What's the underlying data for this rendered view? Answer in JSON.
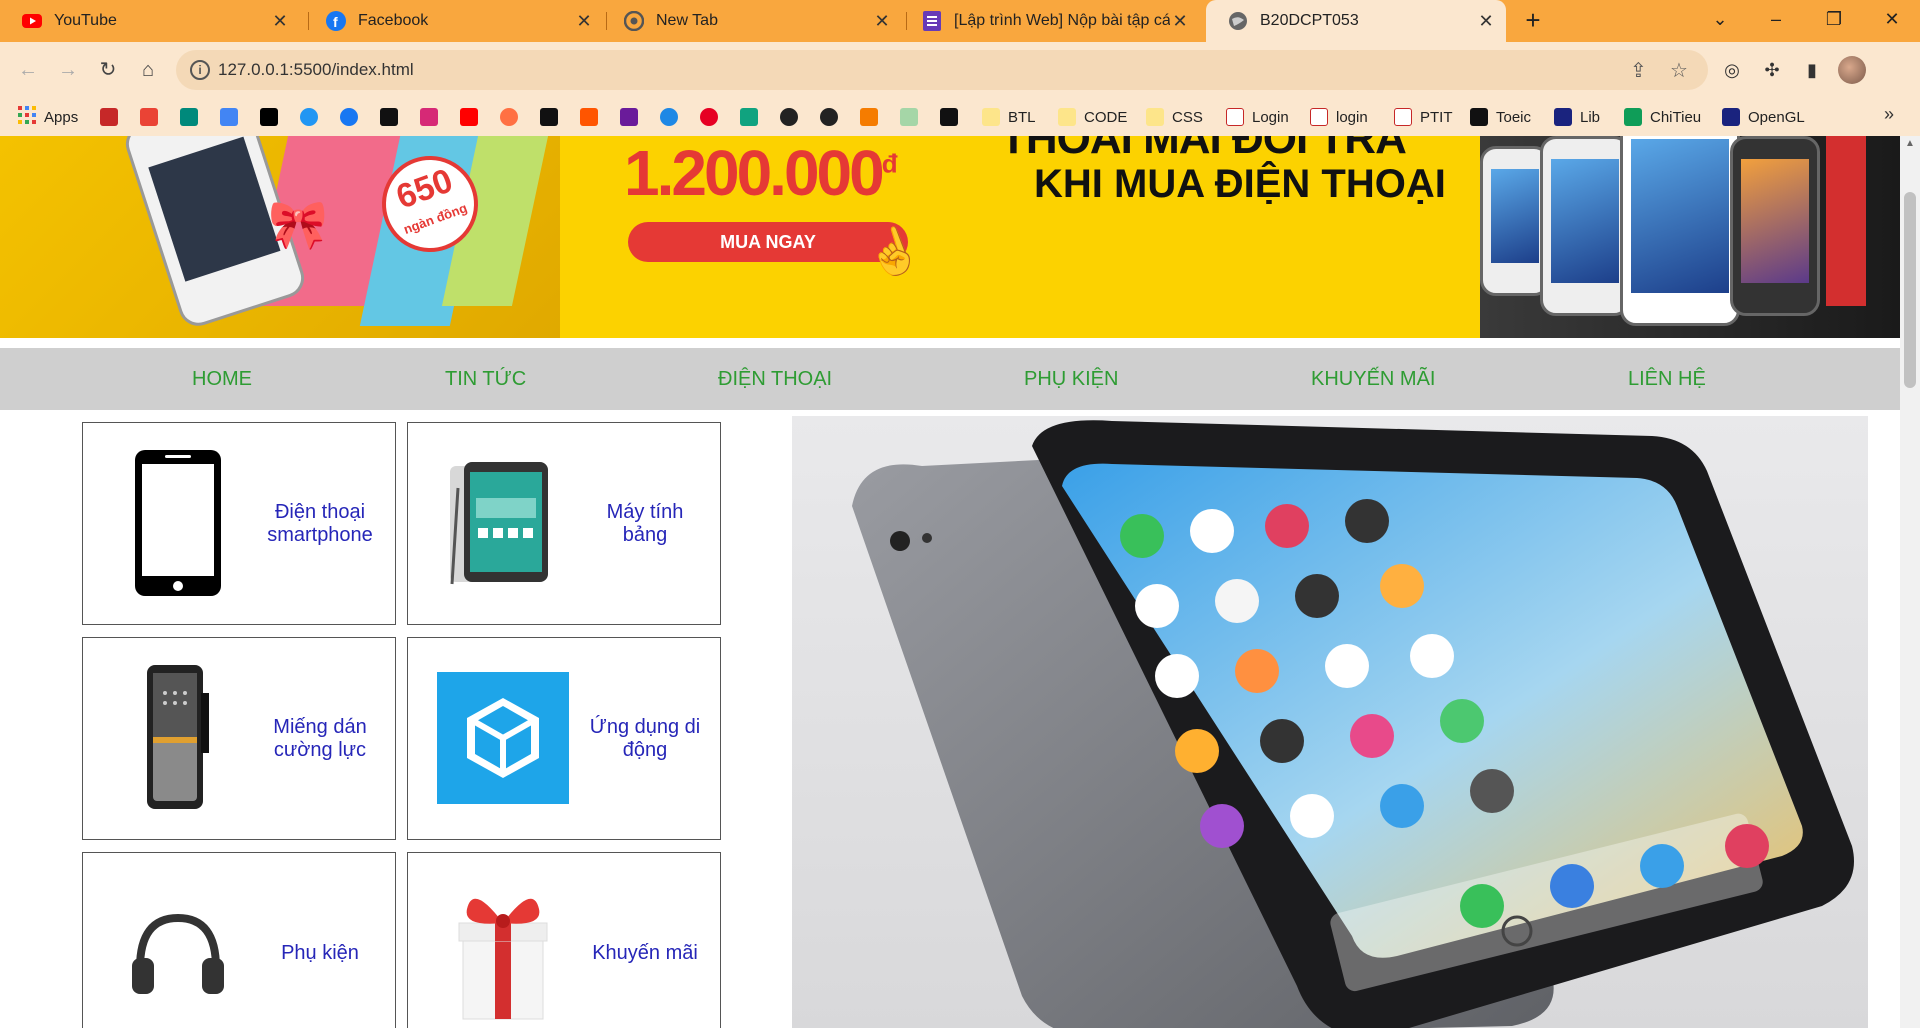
{
  "tabs": [
    {
      "title": "YouTube",
      "icon": "youtube-icon"
    },
    {
      "title": "Facebook",
      "icon": "facebook-icon"
    },
    {
      "title": "New Tab",
      "icon": "chrome-icon"
    },
    {
      "title": "[Lập trình Web] Nộp bài tập cá nhân",
      "icon": "forms-icon"
    },
    {
      "title": "B20DCPT053",
      "icon": "globe-icon"
    }
  ],
  "address_bar": {
    "url": "127.0.0.1:5500/index.html"
  },
  "bookmarks": [
    {
      "label": "Apps"
    },
    {
      "label": "BTL"
    },
    {
      "label": "CODE"
    },
    {
      "label": "CSS"
    },
    {
      "label": "Login"
    },
    {
      "label": "login"
    },
    {
      "label": "PTIT"
    },
    {
      "label": "Toeic"
    },
    {
      "label": "Lib"
    },
    {
      "label": "ChiTieu"
    },
    {
      "label": "OpenGL"
    }
  ],
  "banner": {
    "price": "1.200.000",
    "currency": "đ",
    "buy_label": "MUA NGAY",
    "badge_number": "650",
    "badge_unit": "ngàn đồng",
    "headline1": "THOẢI MÁI ĐỔI TRẢ",
    "headline2": "KHI MUA ĐIỆN THOẠI"
  },
  "menu": [
    "HOME",
    "TIN TỨC",
    "ĐIỆN THOẠI",
    "PHỤ KIỆN",
    "KHUYẾN MÃI",
    "LIÊN HỆ"
  ],
  "categories": [
    {
      "line1": "Điện thoại",
      "line2": "smartphone"
    },
    {
      "line1": "Máy tính",
      "line2": "bảng"
    },
    {
      "line1": "Miếng dán",
      "line2": "cường lực"
    },
    {
      "line1": "Ứng dụng di",
      "line2": "động"
    },
    {
      "line1": "Phụ kiện",
      "line2": ""
    },
    {
      "line1": "Khuyến mãi",
      "line2": ""
    }
  ],
  "colors": {
    "tabbar": "#f9a73e",
    "menu_text": "#2e9c33",
    "category_text": "#2626b8",
    "menu_bg": "#cfcfcf",
    "banner_bg": "#fcd200"
  }
}
